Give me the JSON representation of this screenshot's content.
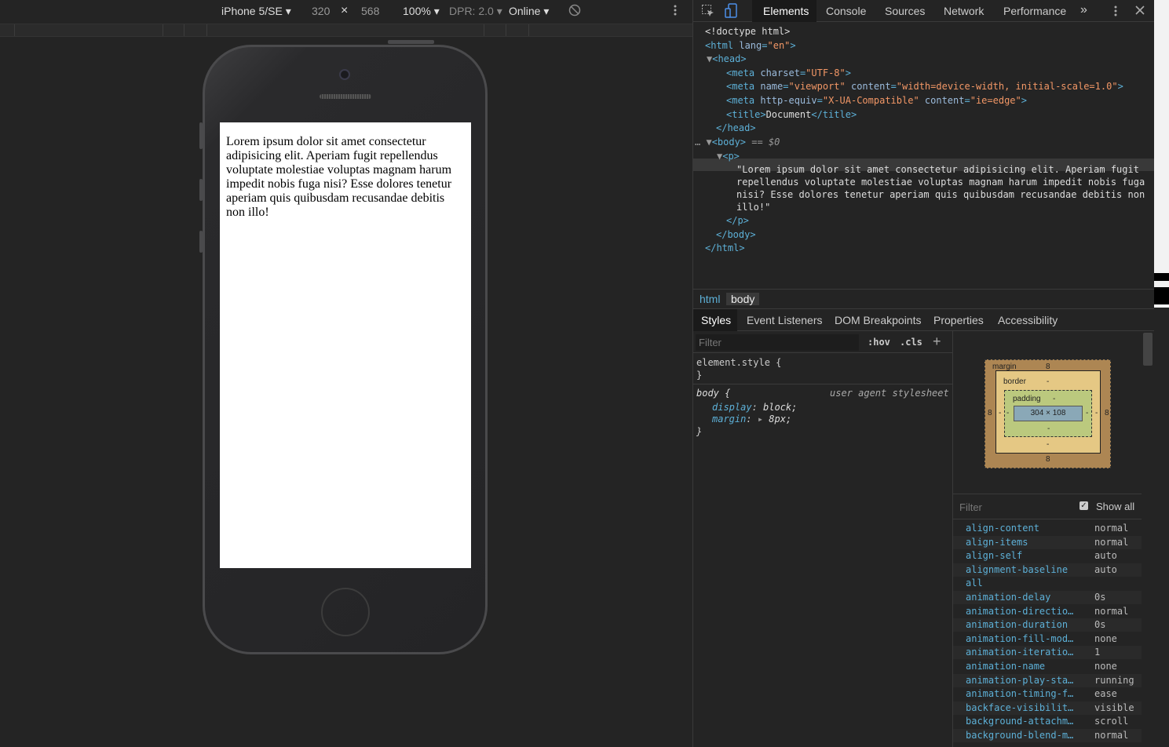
{
  "device_toolbar": {
    "device": "iPhone 5/SE ▾",
    "width": "320",
    "times": "×",
    "height": "568",
    "zoom": "100% ▾",
    "dpr": "DPR: 2.0 ▾",
    "network": "Online ▾",
    "rotate_icon": "rotate-icon",
    "menu_icon": "more-vert-icon"
  },
  "page_text": "Lorem ipsum dolor sit amet consectetur adipisicing elit. Aperiam fugit repellendus voluptate molestiae voluptas magnam harum impedit nobis fuga nisi? Esse dolores tenetur aperiam quis quibusdam recusandae debitis non illo!",
  "devtools_tabs": [
    "Elements",
    "Console",
    "Sources",
    "Network",
    "Performance",
    "»"
  ],
  "dom": {
    "doctype": "<!doctype html>",
    "html_open": "<html",
    "lang_attr": "lang",
    "lang_val": "\"en\"",
    "head": "<head>",
    "meta1_attr": "charset",
    "meta1_val": "\"UTF-8\"",
    "meta2_a1": "name",
    "meta2_v1": "\"viewport\"",
    "meta2_a2": "content",
    "meta2_v2": "\"width=device-width, initial-scale=1.0\"",
    "meta3_a1": "http-equiv",
    "meta3_v1": "\"X-UA-Compatible\"",
    "meta3_a2": "content",
    "meta3_v2": "\"ie=edge\"",
    "title_open": "<title>",
    "title_text": "Document",
    "title_close": "</title>",
    "head_close": "</head>",
    "body_open": "<body>",
    "body_marker": "== $0",
    "p_open": "<p>",
    "p_text1": "\"Lorem ipsum dolor sit amet consectetur adipisicing elit. Aperiam fugit",
    "p_text2": "repellendus voluptate molestiae voluptas magnam harum impedit nobis fuga",
    "p_text3": "nisi? Esse dolores tenetur aperiam quis quibusdam recusandae debitis non",
    "p_text4": "illo!\"",
    "p_close": "</p>",
    "body_close": "</body>",
    "html_close": "</html>"
  },
  "breadcrumbs": [
    "html",
    "body"
  ],
  "subtabs": [
    "Styles",
    "Event Listeners",
    "DOM Breakpoints",
    "Properties",
    "Accessibility"
  ],
  "styles": {
    "filter_placeholder": "Filter",
    "hov": ":hov",
    "cls": ".cls",
    "plus": "+",
    "element_style": "element.style {",
    "close_brace": "}",
    "body_selector": "body {",
    "ua_label": "user agent stylesheet",
    "prop1_name": "display",
    "prop1_val": "block;",
    "prop2_name": "margin",
    "prop2_val": "8px;"
  },
  "box_model": {
    "margin_label": "margin",
    "margin_top": "8",
    "margin_bottom": "8",
    "margin_left": "8",
    "margin_right": "8",
    "border_label": "border",
    "border_val": "-",
    "padding_label": "padding",
    "padding_val": "-",
    "content": "304 × 108"
  },
  "computed": {
    "filter_placeholder": "Filter",
    "show_all": "Show all",
    "rows": [
      {
        "name": "align-content",
        "value": "normal"
      },
      {
        "name": "align-items",
        "value": "normal"
      },
      {
        "name": "align-self",
        "value": "auto"
      },
      {
        "name": "alignment-baseline",
        "value": "auto"
      },
      {
        "name": "all",
        "value": ""
      },
      {
        "name": "animation-delay",
        "value": "0s"
      },
      {
        "name": "animation-directio…",
        "value": "normal"
      },
      {
        "name": "animation-duration",
        "value": "0s"
      },
      {
        "name": "animation-fill-mod…",
        "value": "none"
      },
      {
        "name": "animation-iteratio…",
        "value": "1"
      },
      {
        "name": "animation-name",
        "value": "none"
      },
      {
        "name": "animation-play-sta…",
        "value": "running"
      },
      {
        "name": "animation-timing-f…",
        "value": "ease"
      },
      {
        "name": "backface-visibilit…",
        "value": "visible"
      },
      {
        "name": "background-attachm…",
        "value": "scroll"
      },
      {
        "name": "background-blend-m…",
        "value": "normal"
      }
    ]
  }
}
